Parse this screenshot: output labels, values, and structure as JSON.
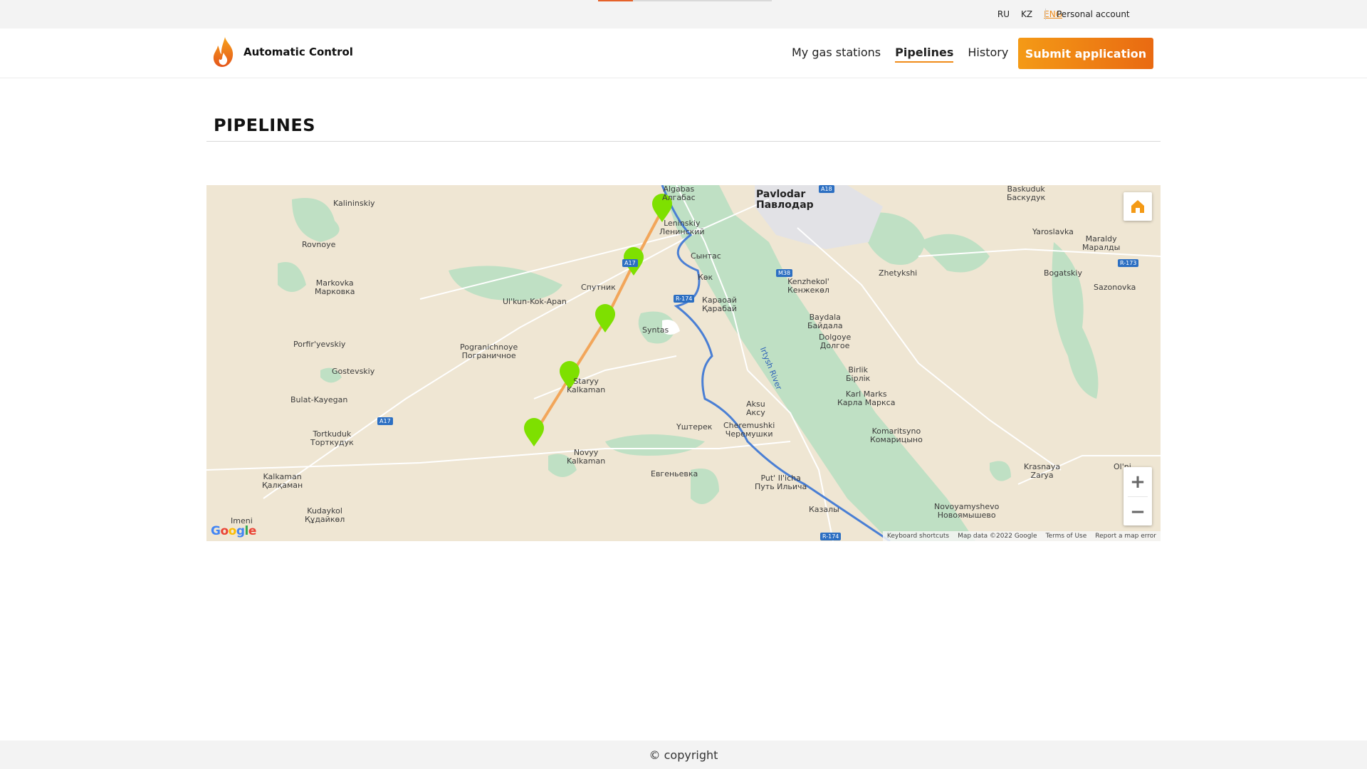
{
  "topbar": {
    "languages": [
      {
        "code": "RU",
        "active": false
      },
      {
        "code": "KZ",
        "active": false
      },
      {
        "code": "ENG",
        "active": true
      }
    ],
    "account_label": "Personal account",
    "loading_progress": 0.2
  },
  "header": {
    "brand": "Automatic Control",
    "nav": [
      {
        "label": "My gas stations",
        "active": false
      },
      {
        "label": "Pipelines",
        "active": true
      },
      {
        "label": "History",
        "active": false
      }
    ],
    "submit_label": "Submit application"
  },
  "page": {
    "title": "PIPELINES"
  },
  "map": {
    "labels": {
      "pavlodar": "Pavlodar",
      "pavlodar_kz": "Павлодар",
      "algabas": "Algabas",
      "algabas_kz": "Алгабас",
      "leninskiy": "Leninskiy",
      "leninskiy_ru": "Ленинский",
      "syntas_ru": "Сынтас",
      "kok": "Көк",
      "kargoay": "Караоай",
      "kargoay_kz": "Қарабай",
      "syntas": "Syntas",
      "kalininskiy": "Kalininskiy",
      "rovnoye": "Rovnoye",
      "markovka": "Markovka",
      "markovka_ru": "Марковка",
      "sputnik": "Спутник",
      "ulkun": "Ul'kun-Kok-Apan",
      "porfiryevskiy": "Porfir'yevskiy",
      "pogranichnoye": "Pogranichnoye",
      "pogranichnoye_ru": "Пограничное",
      "gostevskiy": "Gostevskiy",
      "staryy": "Staryy",
      "kalkaman_s": "Kalkaman",
      "bulat": "Bulat-Kayegan",
      "tortkuduk": "Tortkuduk",
      "tortkuduk_kz": "Торткудук",
      "novyy": "Novyy",
      "kalkaman_n": "Kalkaman",
      "kalkaman": "Kalkaman",
      "kalkaman_kz": "Қалқаман",
      "kudaykol": "Kudaykol",
      "kudaykol_kz": "Құдайкөл",
      "imeni": "Imeni",
      "evgenevka": "Евгеньевка",
      "ushterek": "Үштерек",
      "aksu": "Aksu",
      "aksu_ru": "Аксу",
      "cheremushki": "Cheremushki",
      "cheremushki_ru": "Черемушки",
      "putilicha": "Put' Il'icha",
      "putilicha_ru": "Путь Ильича",
      "kazaly": "Казалы",
      "kenzhekol": "Kenzhekol'",
      "kenzhekol_kz": "Кенжекөл",
      "zhetykshi": "Zhetykshi",
      "baydala": "Baydala",
      "baydala_ru": "Байдала",
      "dolgoye": "Dolgoye",
      "dolgoye_ru": "Долгое",
      "birlik": "Birlik",
      "birlik_kz": "Бірлік",
      "karlmarks": "Karl Marks",
      "karlmarks_ru": "Карла Маркса",
      "komaritsyno": "Komaritsyno",
      "komaritsyno_ru": "Комарицыно",
      "novoyamyshevo": "Novoyamyshevo",
      "novoyamyshevo_ru": "Новоямышево",
      "krasnaya": "Krasnaya",
      "zarya": "Zarya",
      "olini": "Ol'ni",
      "baskuduk": "Baskuduk",
      "baskuduk_ru": "Баскудук",
      "yaroslavka": "Yaroslavka",
      "maraldy": "Maraldy",
      "maraldy_ru": "Маралды",
      "bogatskiy": "Bogatskiy",
      "sazonovka": "Sazonovka",
      "river": "Irtysh River"
    },
    "shields": {
      "a17_n": "A17",
      "a17_s": "A17",
      "r174_n": "R-174",
      "r174_s": "R-174",
      "m38": "M38",
      "a18": "A18",
      "r173": "R-173"
    },
    "attribution": {
      "shortcuts": "Keyboard shortcuts",
      "mapdata": "Map data ©2022 Google",
      "terms": "Terms of Use",
      "report": "Report a map error"
    },
    "colors": {
      "pipeline": "#f2a65a",
      "marker": "#7ee000",
      "water": "#2f63b8",
      "land": "#efe6d3",
      "forest": "#bfe0c4"
    }
  },
  "footer": {
    "copyright": "© copyright"
  }
}
